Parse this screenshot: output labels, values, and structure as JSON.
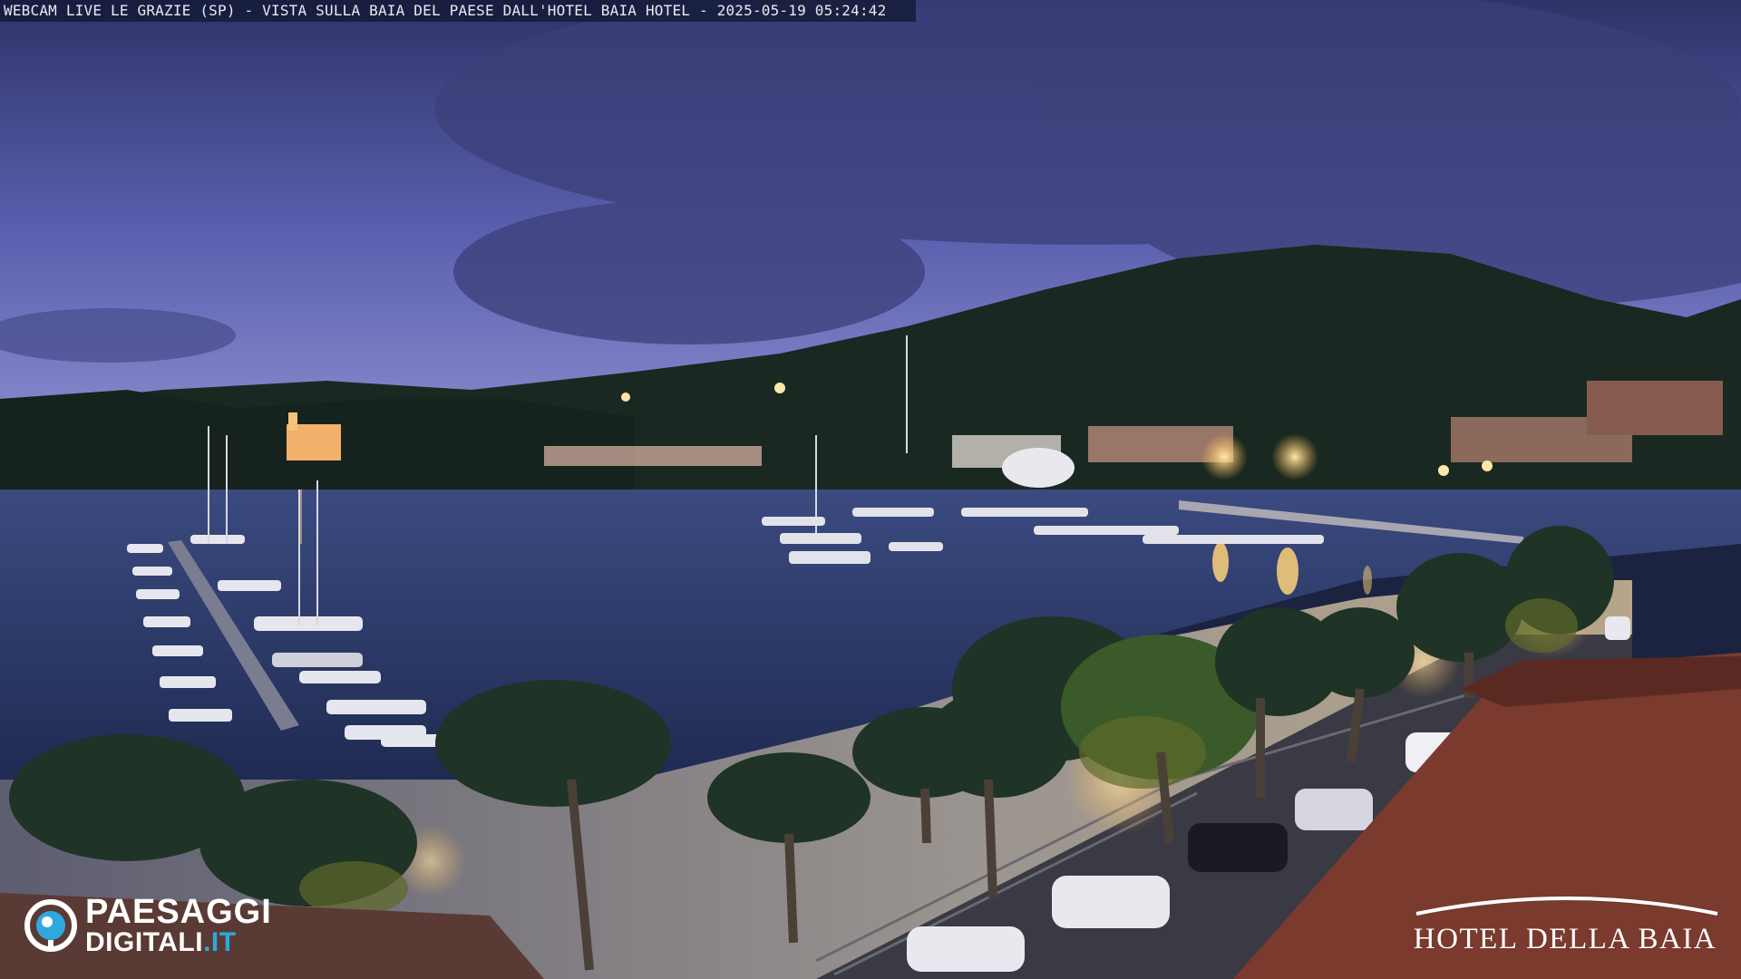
{
  "overlay": {
    "caption": "WEBCAM LIVE LE GRAZIE (SP) - VISTA SULLA BAIA DEL PAESE DALL'HOTEL BAIA HOTEL - 2025-05-19 05:24:42"
  },
  "branding": {
    "left_logo": {
      "line1": "PAESAGGI",
      "line2_main": "DIGITALI",
      "line2_tld": ".IT",
      "colors": {
        "text": "#ffffff",
        "accent": "#2fa8df"
      }
    },
    "right_logo": {
      "name": "HOTEL DELLA BAIA",
      "color": "#ffffff"
    }
  },
  "scene": {
    "description_icons": [
      "sky",
      "mountain",
      "bay-water",
      "marina-pier",
      "palm-trees",
      "promenade",
      "street-lights",
      "cars",
      "rooftop"
    ],
    "colors": {
      "sky_top": "#3a3f7a",
      "sky_bottom": "#8a8fd0",
      "mountain": "#1a2a22",
      "water": "#2e3f6e",
      "promenade": "#8b8990",
      "roof": "#7a3a2e",
      "light": "#ffd27a"
    }
  }
}
